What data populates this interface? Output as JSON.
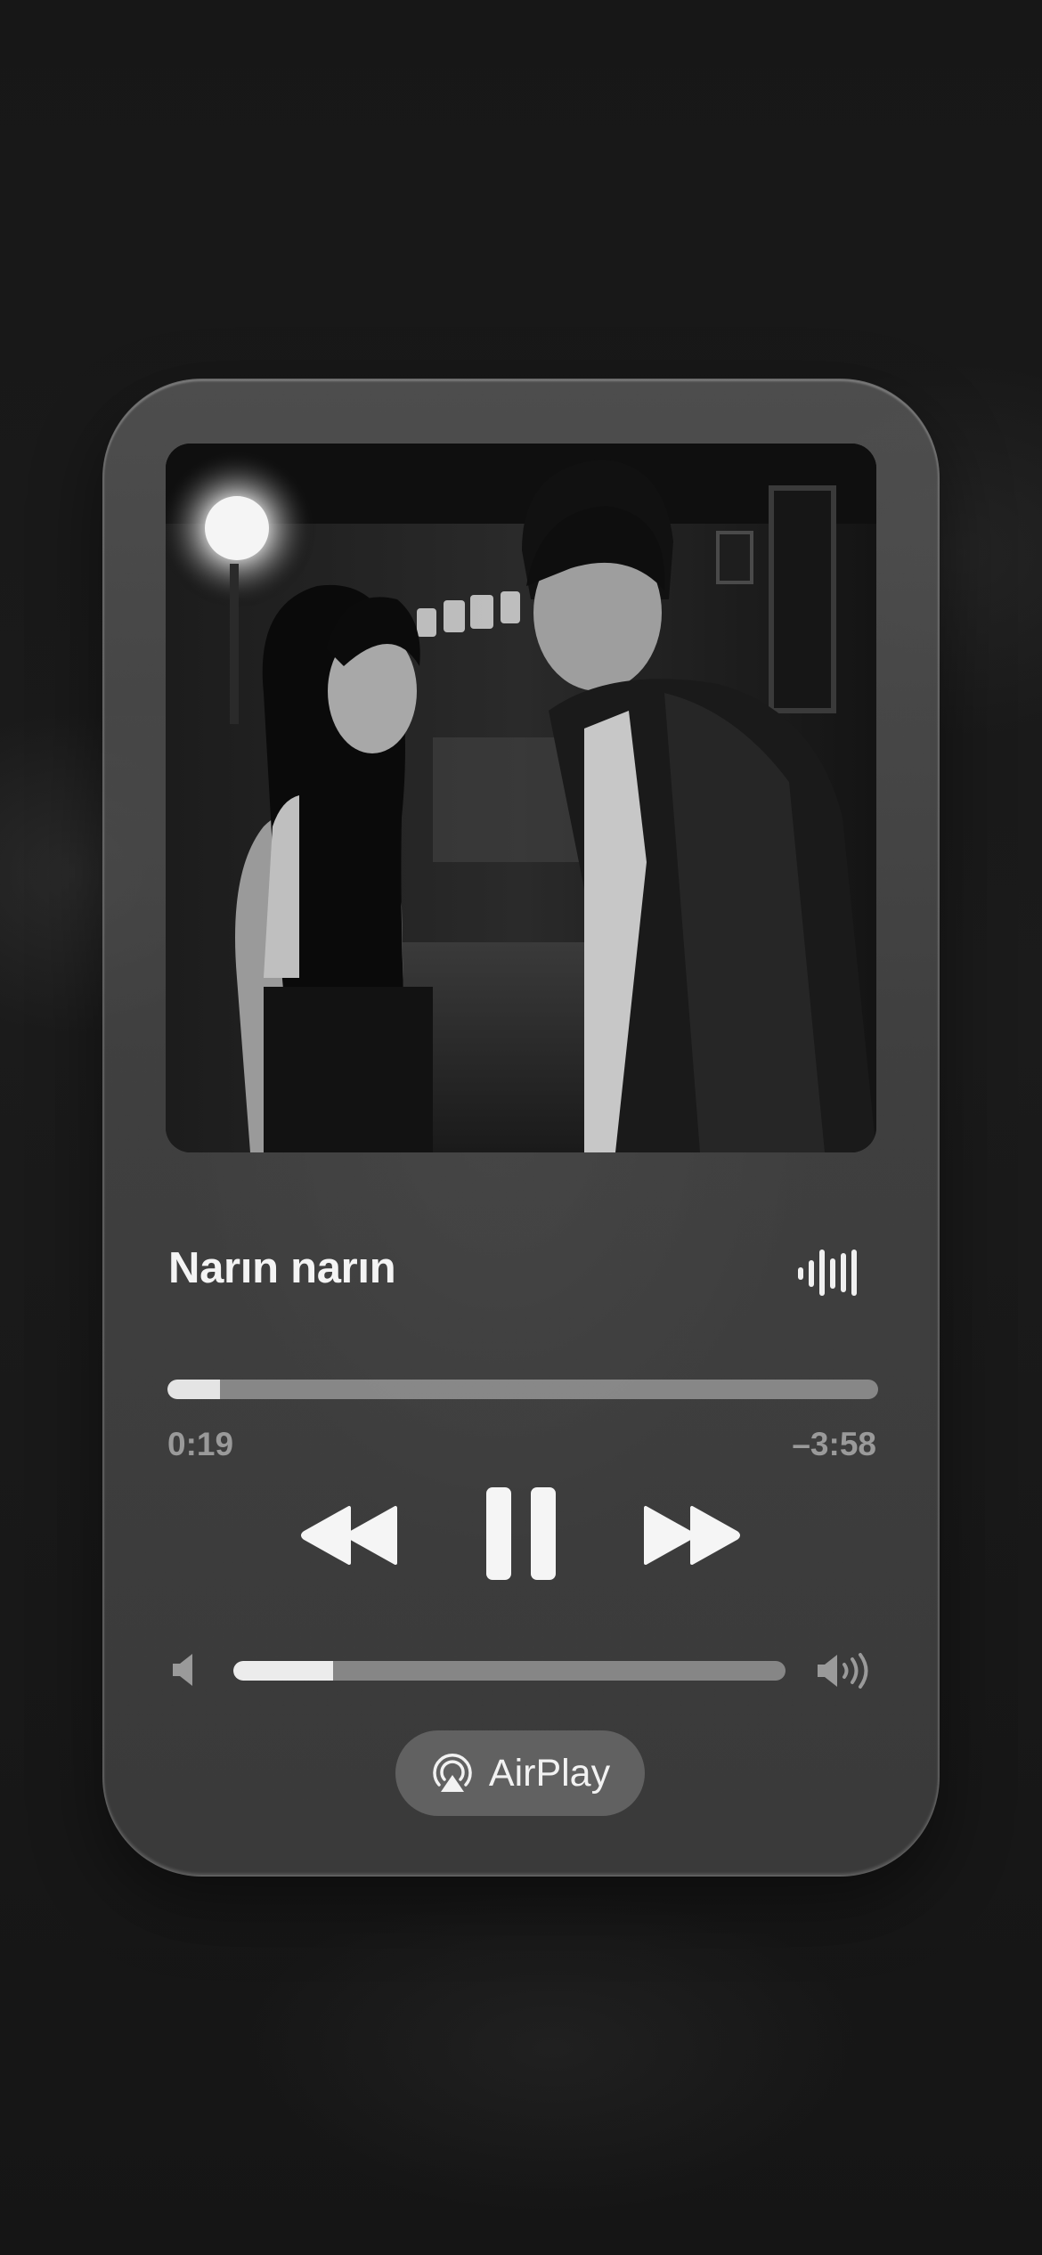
{
  "track": {
    "title": "Narın narın",
    "artwork_icon": "album-artwork-image"
  },
  "playback": {
    "elapsed": "0:19",
    "remaining": "–3:58",
    "progress_fraction": 0.074
  },
  "volume": {
    "level_fraction": 0.18
  },
  "controls": {
    "rewind_icon": "rewind-icon",
    "pause_icon": "pause-icon",
    "forward_icon": "fast-forward-icon",
    "waveform_icon": "waveform-icon",
    "volume_low_icon": "speaker-low-icon",
    "volume_high_icon": "speaker-high-icon"
  },
  "airplay": {
    "label": "AirPlay",
    "icon": "airplay-icon"
  },
  "colors": {
    "accent_fill": "#e4e4e4",
    "track_bg": "#a0a0a0",
    "secondary_text": "#9a9a9a"
  }
}
